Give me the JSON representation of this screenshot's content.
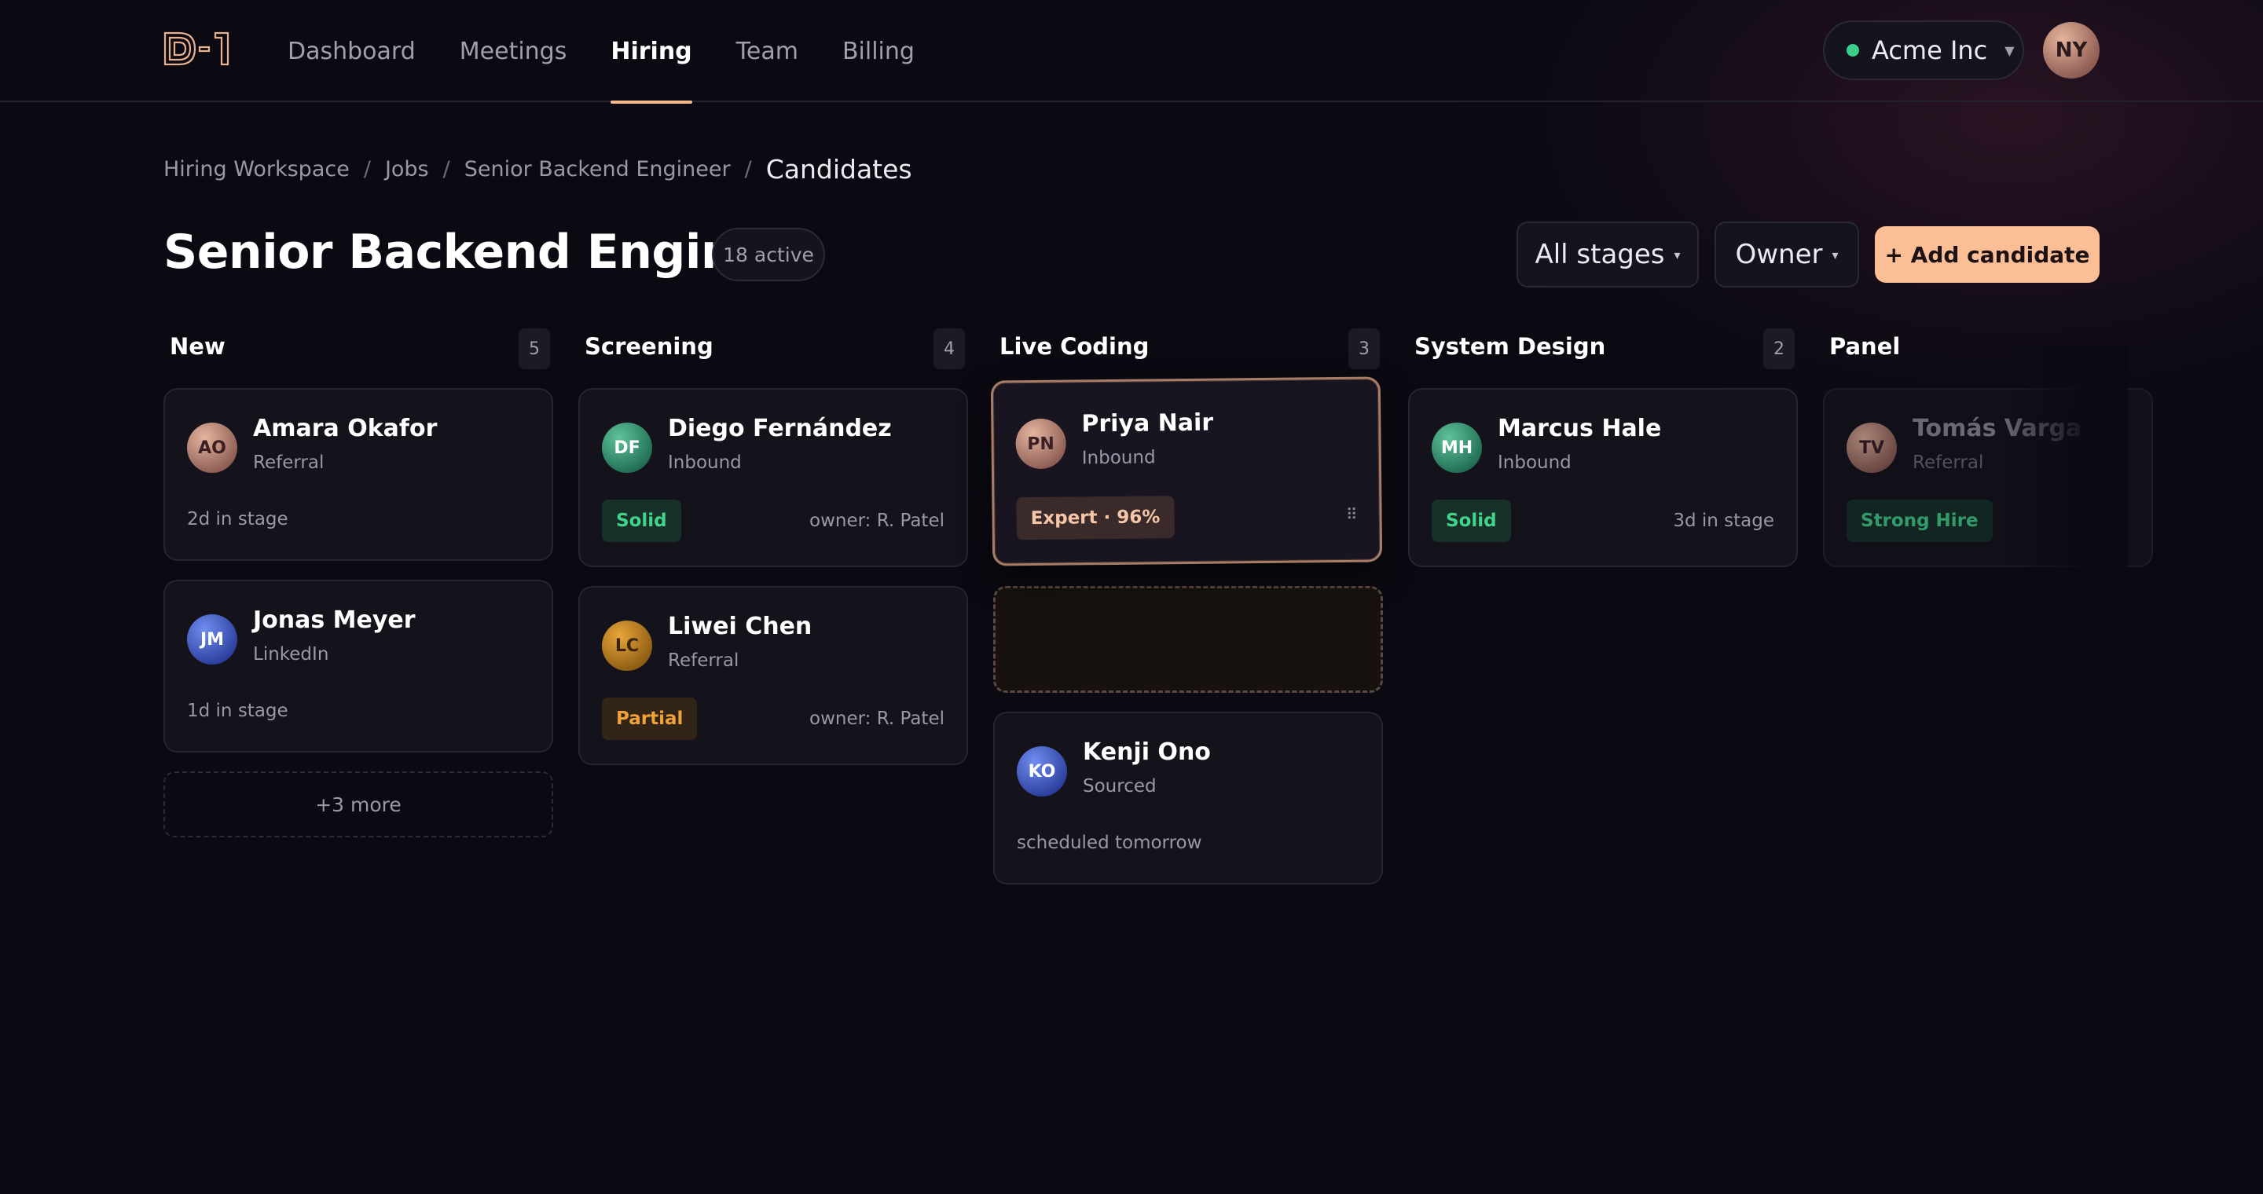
{
  "nav": {
    "items": [
      {
        "label": "Dashboard",
        "active": false
      },
      {
        "label": "Meetings",
        "active": false
      },
      {
        "label": "Hiring",
        "active": true
      },
      {
        "label": "Team",
        "active": false
      },
      {
        "label": "Billing",
        "active": false
      }
    ],
    "org": "Acme Inc",
    "org_status_color": "#3ad08a",
    "user_initials": "NY"
  },
  "breadcrumb": [
    "Hiring Workspace",
    "Jobs",
    "Senior Backend Engineer",
    "Candidates"
  ],
  "header": {
    "title": "Senior Backend Engineer",
    "badge": "18 active",
    "filters": {
      "stages": "All stages",
      "owner": "Owner"
    },
    "add_button": "+ Add candidate"
  },
  "columns": [
    {
      "title": "New",
      "count": "5"
    },
    {
      "title": "Screening",
      "count": "4"
    },
    {
      "title": "Live Coding",
      "count": "3"
    },
    {
      "title": "System Design",
      "count": "2"
    },
    {
      "title": "Panel",
      "count": ""
    }
  ],
  "cards": {
    "amara": {
      "initials": "AO",
      "name": "Amara Okafor",
      "source": "Referral",
      "meta": "2d in stage"
    },
    "jonas": {
      "initials": "JM",
      "name": "Jonas Meyer",
      "source": "LinkedIn",
      "meta": "1d in stage"
    },
    "new_more": "+3 more",
    "diego": {
      "initials": "DF",
      "name": "Diego Fernández",
      "source": "Inbound",
      "tag": "Solid",
      "meta": "owner: R. Patel"
    },
    "liwei": {
      "initials": "LC",
      "name": "Liwei Chen",
      "source": "Referral",
      "tag": "Partial",
      "meta": "owner: R. Patel"
    },
    "priya": {
      "initials": "PN",
      "name": "Priya Nair",
      "source": "Inbound",
      "tag": "Expert · 96%"
    },
    "kenji": {
      "initials": "KO",
      "name": "Kenji Ono",
      "source": "Sourced",
      "meta": "scheduled tomorrow"
    },
    "marcus": {
      "initials": "MH",
      "name": "Marcus Hale",
      "source": "Inbound",
      "tag": "Solid",
      "meta": "3d in stage"
    },
    "tomas": {
      "initials": "TV",
      "name": "Tomás Varga",
      "source": "Referral",
      "tag": "Strong Hire"
    }
  },
  "colors": {
    "accent": "#fcbf95",
    "success": "#43d48c",
    "warning": "#f0a23a"
  }
}
